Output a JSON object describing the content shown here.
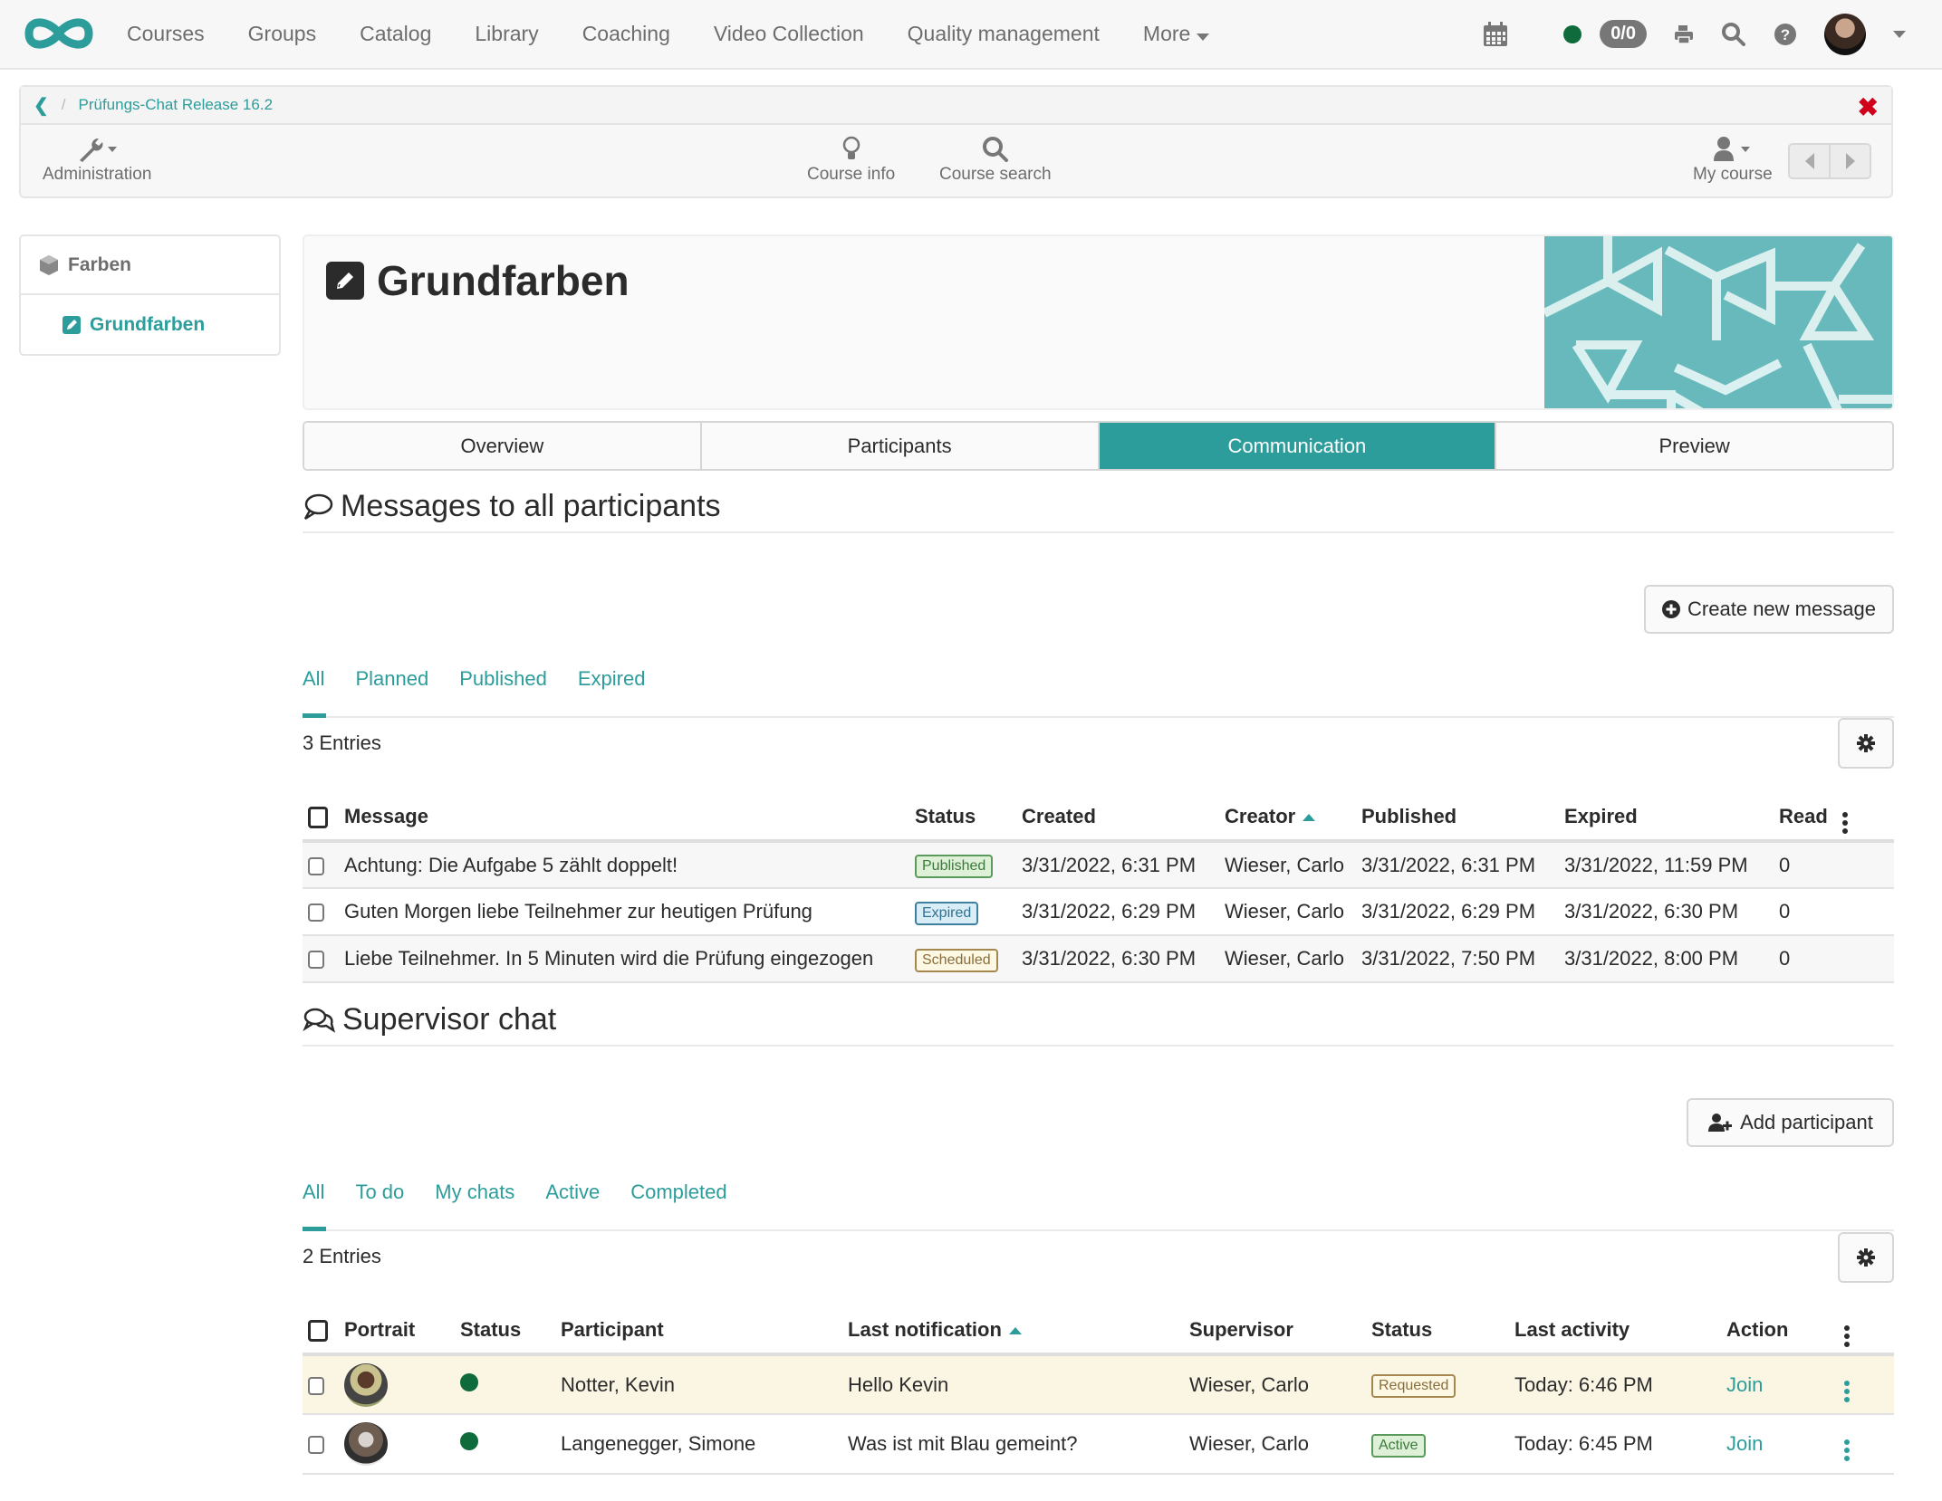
{
  "topnav": {
    "logo": "infinity-logo",
    "items": [
      "Courses",
      "Groups",
      "Catalog",
      "Library",
      "Coaching",
      "Video Collection",
      "Quality management",
      "More"
    ],
    "counter": "0/0",
    "status_color": "#0f6b3b",
    "accent": "#2c9d9b"
  },
  "coursebar": {
    "breadcrumb": "Prüfungs-Chat Release 16.2",
    "admin_label": "Administration",
    "course_info_label": "Course info",
    "course_search_label": "Course search",
    "my_course_label": "My course"
  },
  "sidebar": {
    "items": [
      {
        "label": "Farben",
        "icon": "cube-icon"
      },
      {
        "label": "Grundfarben",
        "icon": "edit-icon"
      }
    ]
  },
  "header": {
    "title": "Grundfarben"
  },
  "tabs": [
    {
      "label": "Overview",
      "active": false
    },
    {
      "label": "Participants",
      "active": false
    },
    {
      "label": "Communication",
      "active": true
    },
    {
      "label": "Preview",
      "active": false
    }
  ],
  "messages": {
    "title": "Messages to all participants",
    "create_label": "Create new message",
    "filters": [
      "All",
      "Planned",
      "Published",
      "Expired"
    ],
    "entries": "3 Entries",
    "columns": [
      "Message",
      "Status",
      "Created",
      "Creator",
      "Published",
      "Expired",
      "Read"
    ],
    "rows": [
      {
        "message": "Achtung: Die Aufgabe 5 zählt doppelt!",
        "status": "Published",
        "created": "3/31/2022, 6:31 PM",
        "creator": "Wieser, Carlo",
        "published": "3/31/2022, 6:31 PM",
        "expired": "3/31/2022, 11:59 PM",
        "read": "0"
      },
      {
        "message": "Guten Morgen liebe Teilnehmer zur heutigen Prüfung",
        "status": "Expired",
        "created": "3/31/2022, 6:29 PM",
        "creator": "Wieser, Carlo",
        "published": "3/31/2022, 6:29 PM",
        "expired": "3/31/2022, 6:30 PM",
        "read": "0"
      },
      {
        "message": "Liebe Teilnehmer. In 5 Minuten wird die Prüfung eingezogen",
        "status": "Scheduled",
        "created": "3/31/2022, 6:30 PM",
        "creator": "Wieser, Carlo",
        "published": "3/31/2022, 7:50 PM",
        "expired": "3/31/2022, 8:00 PM",
        "read": "0"
      }
    ]
  },
  "chat": {
    "title": "Supervisor chat",
    "add_label": "Add participant",
    "filters": [
      "All",
      "To do",
      "My chats",
      "Active",
      "Completed"
    ],
    "entries": "2 Entries",
    "columns": [
      "Portrait",
      "Status",
      "Participant",
      "Last notification",
      "Supervisor",
      "Status",
      "Last activity",
      "Action"
    ],
    "rows": [
      {
        "participant": "Notter, Kevin",
        "last_notification": "Hello Kevin",
        "supervisor": "Wieser, Carlo",
        "status": "Requested",
        "last_activity": "Today: 6:46 PM",
        "action": "Join"
      },
      {
        "participant": "Langenegger, Simone",
        "last_notification": "Was ist mit Blau gemeint?",
        "supervisor": "Wieser, Carlo",
        "status": "Active",
        "last_activity": "Today: 6:45 PM",
        "action": "Join"
      }
    ]
  }
}
